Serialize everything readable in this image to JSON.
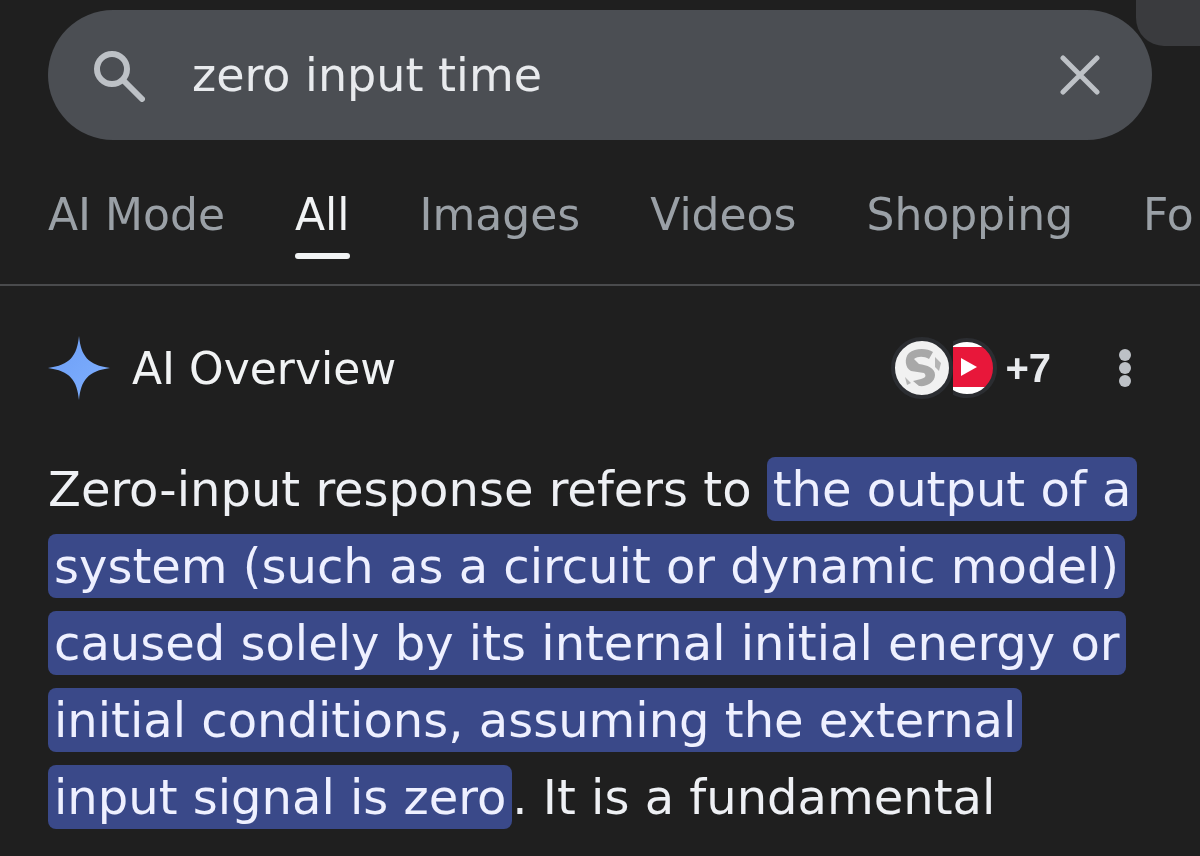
{
  "search": {
    "value": "zero input time"
  },
  "tabs": [
    {
      "label": "AI Mode",
      "selected": false
    },
    {
      "label": "All",
      "selected": true
    },
    {
      "label": "Images",
      "selected": false
    },
    {
      "label": "Videos",
      "selected": false
    },
    {
      "label": "Shopping",
      "selected": false
    },
    {
      "label": "Fo",
      "selected": false
    }
  ],
  "overview": {
    "title": "AI Overview",
    "more_sources": "+7",
    "paragraph": [
      {
        "text": "Zero-input response refers to ",
        "highlighted": false
      },
      {
        "text": "the output of a system (such as a circuit or dynamic model) caused solely by its internal initial energy or initial conditions, assuming the external input signal is zero",
        "highlighted": true
      },
      {
        "text": ". It is a fundamental",
        "highlighted": false
      }
    ]
  }
}
